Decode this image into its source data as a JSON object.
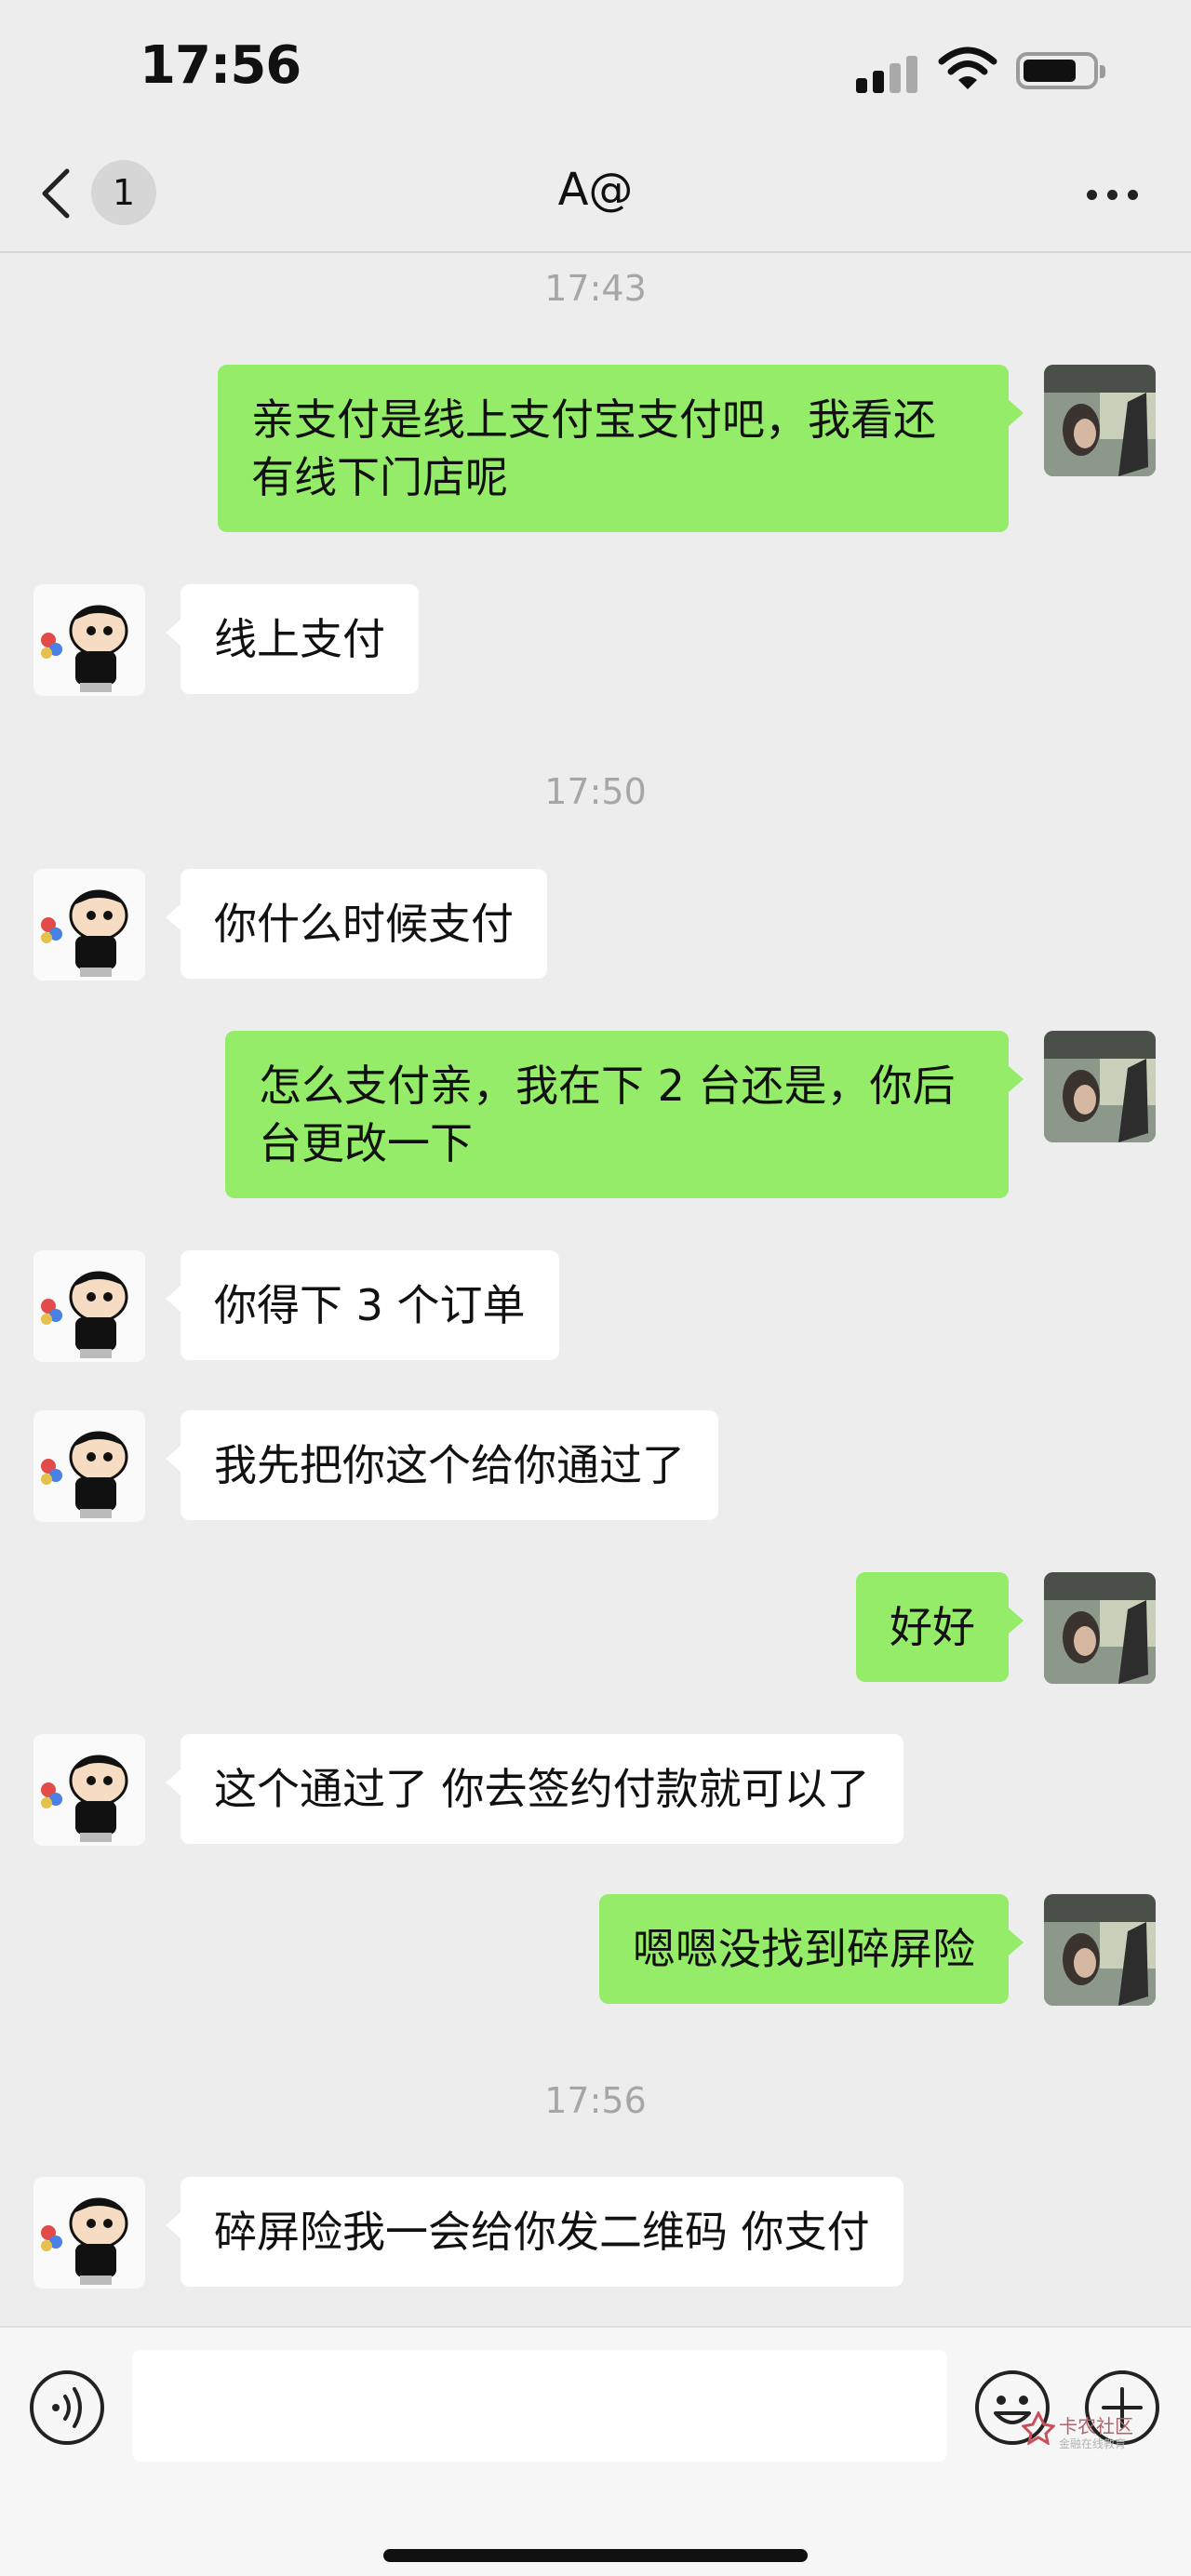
{
  "status_bar": {
    "time": "17:56"
  },
  "nav": {
    "unread_count": "1",
    "title": "A@"
  },
  "messages": [
    {
      "type": "timestamp",
      "text": "17:43"
    },
    {
      "type": "out",
      "text": "亲支付是线上支付宝支付吧，我看还有线下门店呢"
    },
    {
      "type": "in",
      "text": "线上支付"
    },
    {
      "type": "timestamp",
      "text": "17:50"
    },
    {
      "type": "in",
      "text": "你什么时候支付"
    },
    {
      "type": "out",
      "text": "怎么支付亲，我在下 2 台还是，你后台更改一下"
    },
    {
      "type": "in",
      "text": "你得下 3 个订单"
    },
    {
      "type": "in",
      "text": "我先把你这个给你通过了"
    },
    {
      "type": "out",
      "text": "好好"
    },
    {
      "type": "in",
      "text": "这个通过了 你去签约付款就可以了"
    },
    {
      "type": "out",
      "text": "嗯嗯没找到碎屏险"
    },
    {
      "type": "timestamp",
      "text": "17:56"
    },
    {
      "type": "in",
      "text": "碎屏险我一会给你发二维码 你支付"
    }
  ],
  "input": {
    "value": "",
    "placeholder": ""
  },
  "watermark": {
    "title": "卡农社区",
    "subtitle": "金融在线教育"
  },
  "colors": {
    "background": "#ededed",
    "outgoing_bubble": "#95ec69",
    "incoming_bubble": "#ffffff"
  }
}
